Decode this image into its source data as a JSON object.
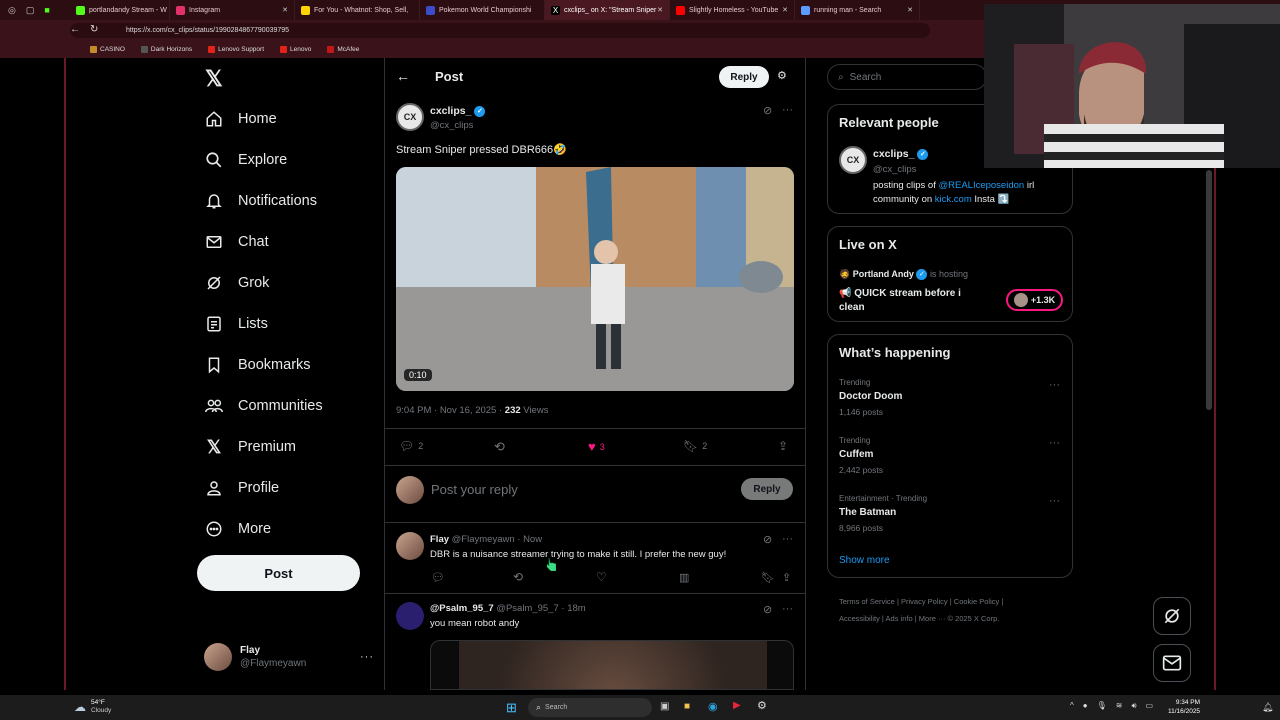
{
  "browser": {
    "tabs": [
      {
        "label": "portlandandy Stream - W",
        "color": "#53fc18"
      },
      {
        "label": "Instagram",
        "color": "#e1306c"
      },
      {
        "label": "For You - Whatnot: Shop, Sell,",
        "color": "#ffd400"
      },
      {
        "label": "Pokemon World Championshi",
        "color": "#3b4cca"
      },
      {
        "label": "cxclips_ on X: \"Stream Sniper",
        "color": "#ffffff"
      },
      {
        "label": "Slightly Homeless - YouTube",
        "color": "#ff0000"
      },
      {
        "label": "running man - Search",
        "color": "#5c9bff"
      }
    ],
    "url": "https://x.com/cx_clips/status/1990284867790039795",
    "bookmarks": [
      {
        "label": "CASINO",
        "color": "#c48b2a"
      },
      {
        "label": "Dark Horizons",
        "color": "#555555"
      },
      {
        "label": "Lenovo Support",
        "color": "#e2231a"
      },
      {
        "label": "Lenovo",
        "color": "#e2231a"
      },
      {
        "label": "McAfee",
        "color": "#c01818"
      }
    ]
  },
  "nav": {
    "items": [
      {
        "label": "Home",
        "icon": "home-icon"
      },
      {
        "label": "Explore",
        "icon": "search-icon"
      },
      {
        "label": "Notifications",
        "icon": "bell-icon"
      },
      {
        "label": "Chat",
        "icon": "mail-icon"
      },
      {
        "label": "Grok",
        "icon": "grok-icon"
      },
      {
        "label": "Lists",
        "icon": "list-icon"
      },
      {
        "label": "Bookmarks",
        "icon": "bookmark-icon"
      },
      {
        "label": "Communities",
        "icon": "people-icon"
      },
      {
        "label": "Premium",
        "icon": "x-icon"
      },
      {
        "label": "Profile",
        "icon": "person-icon"
      },
      {
        "label": "More",
        "icon": "more-icon"
      }
    ],
    "post_label": "Post",
    "me_name": "Flay",
    "me_handle": "@Flaymeyawn"
  },
  "header": {
    "title": "Post",
    "reply_label": "Reply"
  },
  "tweet": {
    "name": "cxclips_",
    "handle": "@cx_clips",
    "text": "Stream Sniper pressed DBR666🤣",
    "video_duration": "0:10",
    "meta_time": "9:04 PM · Nov 16, 2025 · ",
    "views_count": "232",
    "views_label": " Views",
    "replies": "2",
    "likes": "3",
    "bookmarks": "2"
  },
  "composer": {
    "placeholder": "Post your reply",
    "reply_label": "Reply"
  },
  "replies": [
    {
      "name": "Flay",
      "handle": "@Flaymeyawn · Now",
      "text": "DBR is a nuisance streamer trying to make it still. I prefer the new guy!"
    },
    {
      "name": "@Psalm_95_7",
      "handle": "@Psalm_95_7 · 18m",
      "text": "you mean robot andy"
    }
  ],
  "search": {
    "placeholder": "Search"
  },
  "relevant": {
    "title": "Relevant people",
    "name": "cxclips_",
    "handle": "@cx_clips",
    "bio_pre": "posting clips of ",
    "bio_link1": "@REALIceposeidon",
    "bio_mid": " irl community on ",
    "bio_link2": "kick.com",
    "bio_post": " Insta ⤵️"
  },
  "live": {
    "title": "Live on X",
    "host": "Portland Andy",
    "hosting_label": "is hosting",
    "stream_title": "📢 QUICK stream before i clean",
    "listeners": "+1.3K"
  },
  "happening": {
    "title": "What’s happening",
    "trends": [
      {
        "context": "Trending",
        "name": "Doctor Doom",
        "posts": "1,146 posts"
      },
      {
        "context": "Trending",
        "name": "Cuffem",
        "posts": "2,442 posts"
      },
      {
        "context": "Entertainment · Trending",
        "name": "The Batman",
        "posts": "8,966 posts"
      }
    ],
    "show_more": "Show more"
  },
  "footer": {
    "links": [
      "Terms of Service",
      "Privacy Policy",
      "Cookie Policy",
      "Accessibility",
      "Ads info",
      "More ···",
      "© 2025 X Corp."
    ]
  },
  "taskbar": {
    "temp": "54°F",
    "weather": "Cloudy",
    "search_placeholder": "Search",
    "time": "9:34 PM",
    "date": "11/16/2025"
  },
  "colors": {
    "accent": "#1d9bf0",
    "like": "#f91880",
    "frame": "#6a1a26"
  }
}
